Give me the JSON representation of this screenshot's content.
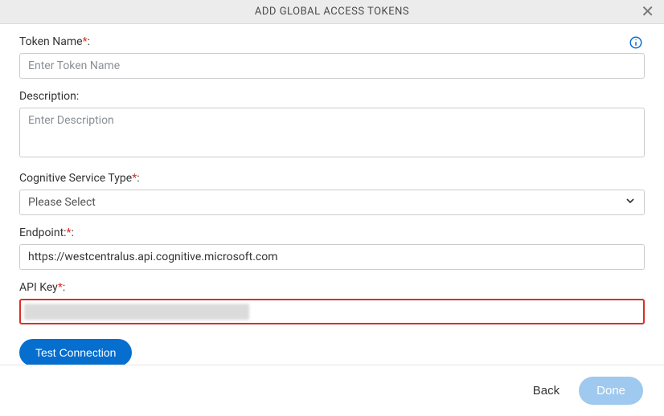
{
  "header": {
    "title": "ADD GLOBAL ACCESS TOKENS"
  },
  "fields": {
    "token_name": {
      "label": "Token Name",
      "placeholder": "Enter Token Name",
      "value": ""
    },
    "description": {
      "label": "Description:",
      "placeholder": "Enter Description",
      "value": ""
    },
    "service_type": {
      "label": "Cognitive Service Type",
      "placeholder": "Please Select",
      "value": ""
    },
    "endpoint": {
      "label": "Endpoint:",
      "value": "https://westcentralus.api.cognitive.microsoft.com"
    },
    "api_key": {
      "label": "API Key",
      "value": ""
    }
  },
  "buttons": {
    "test_connection": "Test Connection",
    "back": "Back",
    "done": "Done"
  }
}
